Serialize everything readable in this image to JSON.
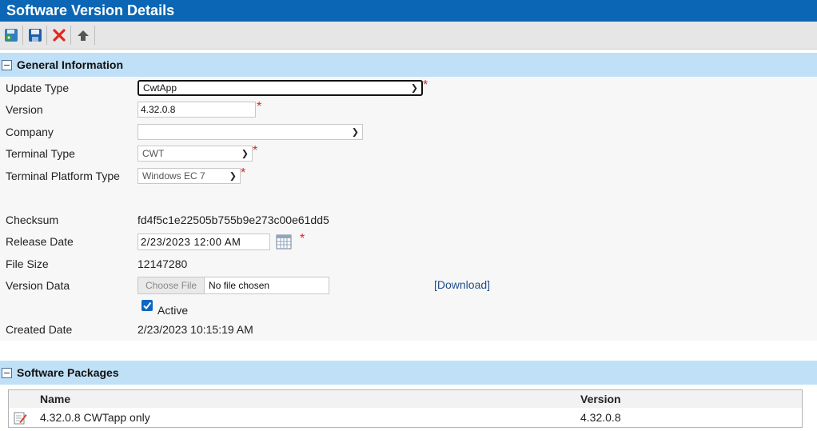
{
  "title": "Software Version Details",
  "toolbar": {
    "buttons": [
      {
        "name": "save-and-new-icon"
      },
      {
        "name": "save-icon"
      },
      {
        "name": "delete-icon"
      },
      {
        "name": "upload-icon"
      }
    ]
  },
  "general": {
    "header": "General Information",
    "update_type": {
      "label": "Update Type",
      "value": "CwtApp"
    },
    "version": {
      "label": "Version",
      "value": "4.32.0.8"
    },
    "company": {
      "label": "Company",
      "value": ""
    },
    "terminal_type": {
      "label": "Terminal Type",
      "value": "CWT"
    },
    "platform_type": {
      "label": "Terminal Platform Type",
      "value": "Windows EC 7"
    },
    "checksum": {
      "label": "Checksum",
      "value": "fd4f5c1e22505b755b9e273c00e61dd5"
    },
    "release_date": {
      "label": "Release Date",
      "value": "2/23/2023 12:00 AM"
    },
    "file_size": {
      "label": "File Size",
      "value": "12147280"
    },
    "version_data": {
      "label": "Version Data",
      "button": "Choose File",
      "status": "No file chosen",
      "download": "[Download]"
    },
    "active": {
      "label": "Active",
      "checked": true
    },
    "created_date": {
      "label": "Created Date",
      "value": "2/23/2023 10:15:19 AM"
    },
    "required_mark": "*"
  },
  "packages": {
    "header": "Software Packages",
    "columns": {
      "name": "Name",
      "version": "Version"
    },
    "rows": [
      {
        "name": "4.32.0.8 CWTapp only",
        "version": "4.32.0.8"
      }
    ]
  },
  "colors": {
    "titlebar": "#0b67b5",
    "section": "#bfe0f7",
    "required": "#e02020",
    "link": "#1f4e8a"
  }
}
